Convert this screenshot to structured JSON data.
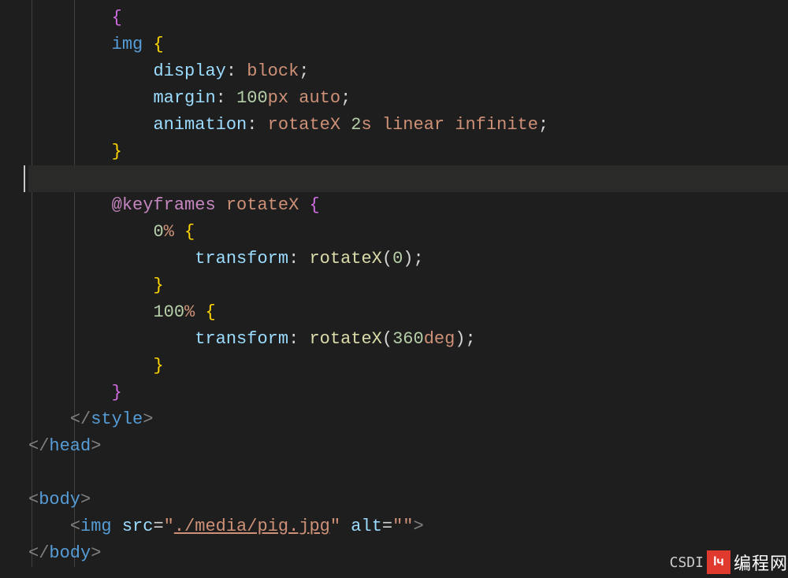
{
  "code": {
    "lines": [
      {
        "ind": 8,
        "type": "brace-open-pink",
        "text": "{"
      },
      {
        "ind": 8,
        "type": "selector",
        "sel": "img",
        "brace": "{"
      },
      {
        "ind": 12,
        "type": "decl",
        "prop": "display",
        "colon": ": ",
        "val": "block",
        "semi": ";"
      },
      {
        "ind": 12,
        "type": "decl2",
        "prop": "margin",
        "colon": ": ",
        "n1": "100",
        "u1": "px",
        "sp": " ",
        "v2": "auto",
        "semi": ";"
      },
      {
        "ind": 12,
        "type": "decl3",
        "prop": "animation",
        "colon": ": ",
        "v1": "rotateX",
        "sp1": " ",
        "n2": "2",
        "u2": "s",
        "sp2": " ",
        "v3": "linear",
        "sp3": " ",
        "v4": "infinite",
        "semi": ";"
      },
      {
        "ind": 8,
        "type": "brace-close",
        "text": "}"
      },
      {
        "ind": 0,
        "type": "blank-highlight"
      },
      {
        "ind": 8,
        "type": "keyframes",
        "kw": "@keyframes",
        "sp": " ",
        "name": "rotateX",
        "sp2": " ",
        "brace": "{"
      },
      {
        "ind": 12,
        "type": "pct",
        "n": "0",
        "u": "%",
        "sp": " ",
        "brace": "{"
      },
      {
        "ind": 16,
        "type": "tfm",
        "prop": "transform",
        "colon": ": ",
        "fn": "rotateX",
        "open": "(",
        "arg": "0",
        "close": ")",
        "semi": ";"
      },
      {
        "ind": 12,
        "type": "brace-close",
        "text": "}"
      },
      {
        "ind": 12,
        "type": "pct",
        "n": "100",
        "u": "%",
        "sp": " ",
        "brace": "{"
      },
      {
        "ind": 16,
        "type": "tfm",
        "prop": "transform",
        "colon": ": ",
        "fn": "rotateX",
        "open": "(",
        "arg": "360deg",
        "close": ")",
        "semi": ";"
      },
      {
        "ind": 12,
        "type": "brace-close",
        "text": "}"
      },
      {
        "ind": 8,
        "type": "brace-close-pink",
        "text": "}"
      },
      {
        "ind": 4,
        "type": "closetag",
        "tag": "style"
      },
      {
        "ind": 0,
        "type": "closetag",
        "tag": "head"
      },
      {
        "ind": 0,
        "type": "blank"
      },
      {
        "ind": 0,
        "type": "opentag",
        "tag": "body"
      },
      {
        "ind": 4,
        "type": "imgtag",
        "tag": "img",
        "a1": "src",
        "eq1": "=",
        "q1": "\"",
        "v1": "./media/pig.jpg",
        "q1c": "\"",
        "a2": "alt",
        "eq2": "=",
        "q2": "\"\"",
        "close": ">"
      },
      {
        "ind": 0,
        "type": "closetag",
        "tag": "body"
      }
    ]
  },
  "guides": [
    40,
    94
  ],
  "watermark": {
    "left": "CSDI",
    "brand": "编程网"
  }
}
